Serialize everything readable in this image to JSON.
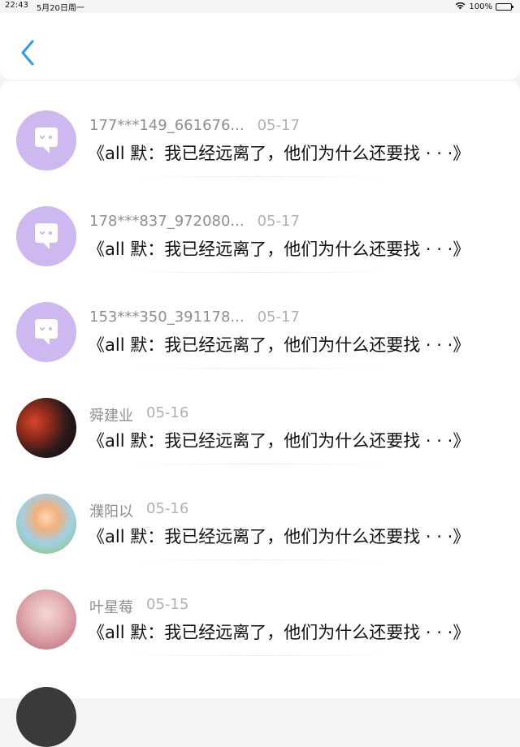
{
  "status_bar": {
    "time": "22:43",
    "date": "5月20日周一",
    "battery": "100%"
  },
  "messages": [
    {
      "name": "177***149_661676...",
      "time": "05-17",
      "preview": "《all 默：我已经远离了，他们为什么还要找 · · ·》",
      "avatar": "bot-icon"
    },
    {
      "name": "178***837_972080...",
      "time": "05-17",
      "preview": "《all 默：我已经远离了，他们为什么还要找 · · ·》",
      "avatar": "bot-icon"
    },
    {
      "name": "153***350_391178...",
      "time": "05-17",
      "preview": "《all 默：我已经远离了，他们为什么还要找 · · ·》",
      "avatar": "bot-icon"
    },
    {
      "name": "舜建业",
      "time": "05-16",
      "preview": "《all 默：我已经远离了，他们为什么还要找 · · ·》",
      "avatar": "photo"
    },
    {
      "name": "濮阳以",
      "time": "05-16",
      "preview": "《all 默：我已经远离了，他们为什么还要找 · · ·》",
      "avatar": "photo"
    },
    {
      "name": "叶星莓",
      "time": "05-15",
      "preview": "《all 默：我已经远离了，他们为什么还要找 · · ·》",
      "avatar": "photo"
    }
  ],
  "colors": {
    "accent": "#2d9cf0",
    "bot_avatar": "#cdb8f0"
  }
}
